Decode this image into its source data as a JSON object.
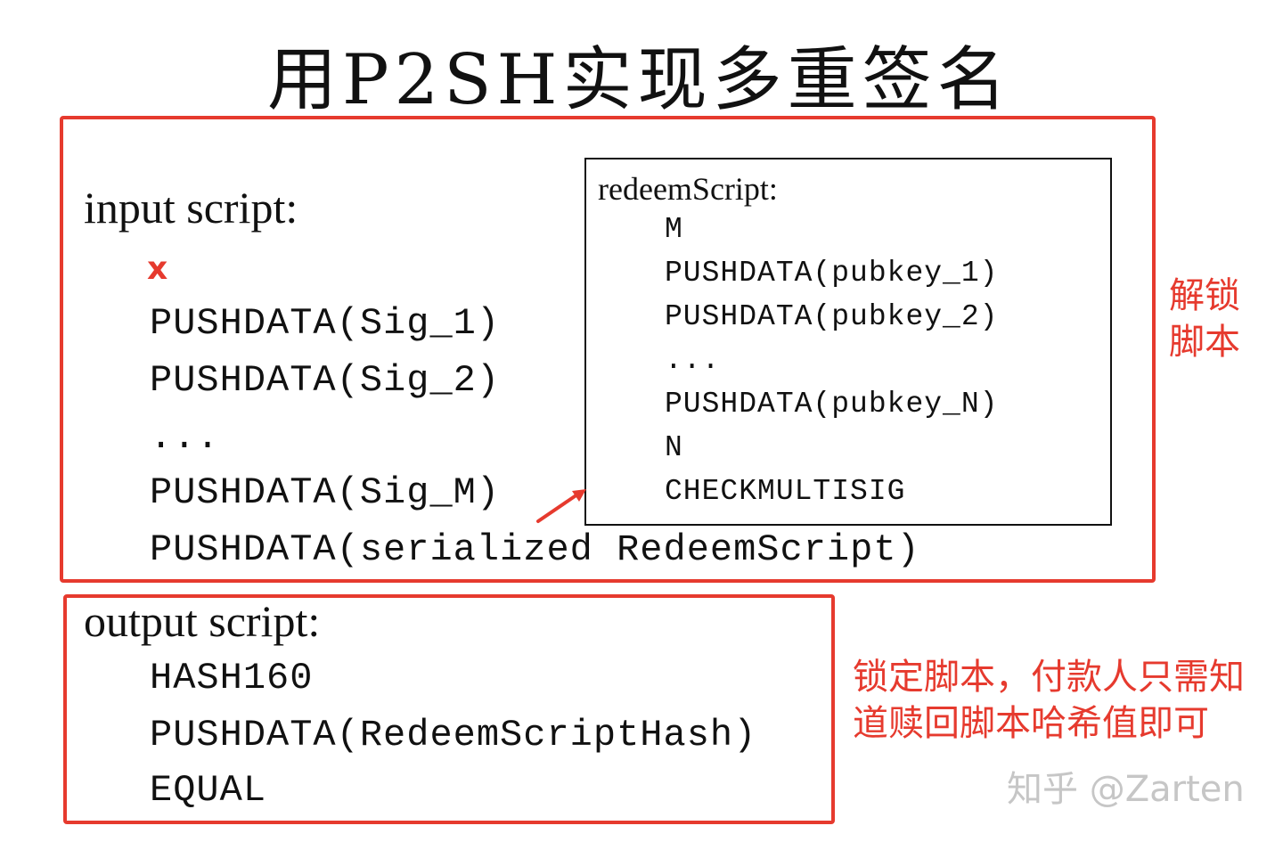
{
  "title": "用P2SH实现多重签名",
  "input_script": {
    "label": "input script:",
    "x_mark": "x",
    "lines": [
      "PUSHDATA(Sig_1)",
      "PUSHDATA(Sig_2)",
      "...",
      "PUSHDATA(Sig_M)",
      "PUSHDATA(serialized RedeemScript)"
    ]
  },
  "redeem_script": {
    "label": "redeemScript:",
    "lines": [
      "M",
      "PUSHDATA(pubkey_1)",
      "PUSHDATA(pubkey_2)",
      "...",
      "PUSHDATA(pubkey_N)",
      "N",
      "CHECKMULTISIG"
    ]
  },
  "output_script": {
    "label": "output script:",
    "lines": [
      "HASH160",
      "PUSHDATA(RedeemScriptHash)",
      "EQUAL"
    ]
  },
  "notes": {
    "unlock": "解锁脚本",
    "lock": "锁定脚本，付款人只需知道赎回脚本哈希值即可"
  },
  "watermark": "知乎 @Zarten",
  "colors": {
    "accent_red": "#e63a2e",
    "text": "#111111",
    "watermark": "#c6c6c6"
  }
}
